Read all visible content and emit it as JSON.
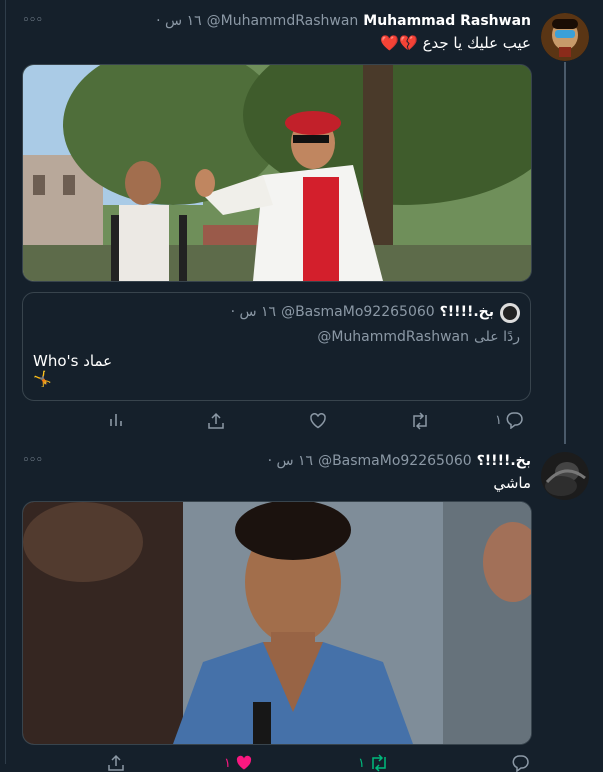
{
  "tweet1": {
    "name": "Muhammad Rashwan",
    "handle": "@MuhammdRashwan",
    "time": "· ١٦ س",
    "text": "عيب عليك يا جدع",
    "emoji": "💔❤️"
  },
  "quote": {
    "name": "بخ.!!!!؟",
    "handle": "@BasmaMo92265060",
    "time": "· ١٦ س",
    "reply_prefix": "ردًا على",
    "reply_handle": "@MuhammdRashwan",
    "text": "Who's عماد",
    "emoji": "🤸"
  },
  "actions1": {
    "reply_count": "١"
  },
  "tweet2": {
    "name": "بخ.!!!!؟",
    "handle": "@BasmaMo92265060",
    "time": "· ١٦ س",
    "text": "ماشي"
  },
  "actions2": {
    "retweet_count": "١",
    "like_count": "١"
  },
  "more_glyph": "◦◦◦",
  "icons": [
    "more-icon",
    "analytics-icon",
    "share-icon",
    "like-icon",
    "retweet-icon",
    "reply-icon",
    "heart-filled-icon"
  ],
  "colors": {
    "background": "#15202b",
    "muted": "#8b98a5",
    "like": "#f91880",
    "retweet": "#00ba7c",
    "border": "#38444d"
  }
}
